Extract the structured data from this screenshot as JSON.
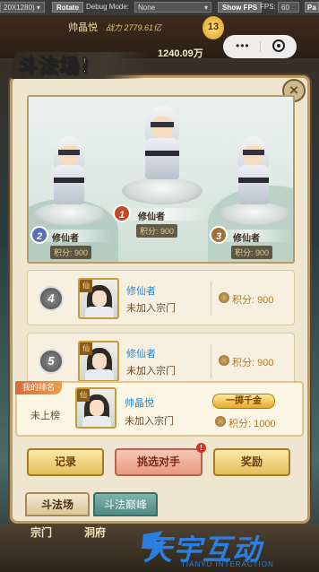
{
  "debug_bar": {
    "resolution": "20X1280)",
    "rotate_label": "Rotate",
    "debug_mode_label": "Debug Mode:",
    "debug_mode_value": "None",
    "show_fps_label": "Show FPS",
    "fps_label": "FPS:",
    "fps_value": "60",
    "pause_label": "Pa"
  },
  "game_header": {
    "player_name": "帅晶悦",
    "power_text": "战力 2779.61亿",
    "vip_level": "13",
    "gold_amount": "1240.09万"
  },
  "panel": {
    "title": "斗法场！",
    "close_glyph": "×"
  },
  "podium": [
    {
      "rank": "1",
      "name": "修仙者",
      "score": "积分: 900",
      "color": "#c5481f"
    },
    {
      "rank": "2",
      "name": "修仙者",
      "score": "积分: 900",
      "color": "#5a6fb8"
    },
    {
      "rank": "3",
      "name": "修仙者",
      "score": "积分: 900",
      "color": "#a0703a"
    }
  ],
  "ranking_list": [
    {
      "rank": "4",
      "avatar_tag": "仙",
      "name": "修仙者",
      "sect": "未加入宗门",
      "score": "积分: 900"
    },
    {
      "rank": "5",
      "avatar_tag": "仙",
      "name": "修仙者",
      "sect": "未加入宗门",
      "score": "积分: 900"
    }
  ],
  "my_rank": {
    "tag": "我的排名",
    "rank_value": "未上榜",
    "avatar_tag": "仙",
    "name": "帅晶悦",
    "sect": "未加入宗门",
    "title_badge": "一掷千金",
    "score": "积分: 1000"
  },
  "buttons": {
    "record": "记录",
    "pick_opponent": "挑选对手",
    "reward": "奖励",
    "alert": "!"
  },
  "tabs": [
    {
      "label": "斗法场",
      "active": true
    },
    {
      "label": "斗法巅峰",
      "active": false
    }
  ],
  "bottom_nav": {
    "item1": "宗门",
    "item2": "洞府"
  },
  "watermark": {
    "text": "天宇互动",
    "sub": "TIANYU INTERACTION"
  },
  "colors": {
    "panel_bg": "#efe6cf",
    "frame": "#b99a63",
    "name_blue": "#2f86c7",
    "score_brown": "#b07a2a"
  }
}
